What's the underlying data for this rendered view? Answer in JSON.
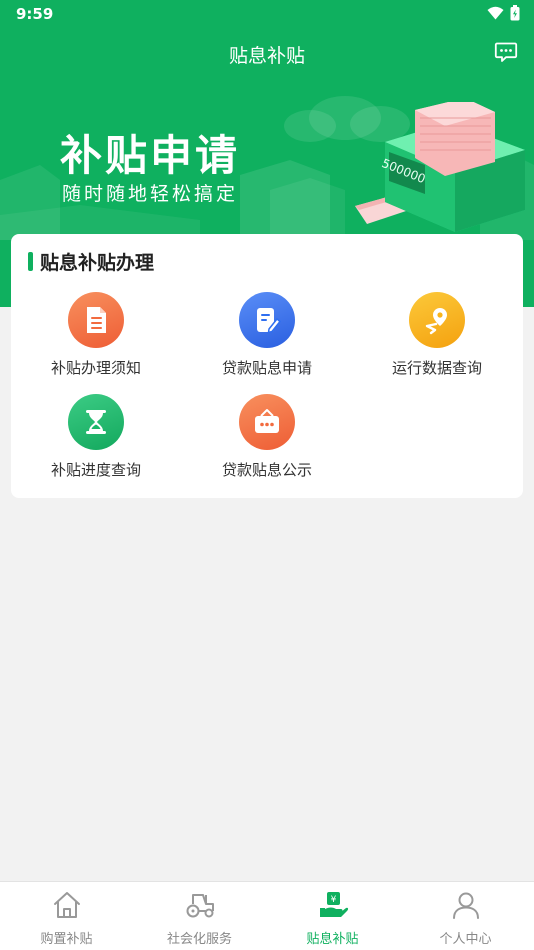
{
  "status": {
    "time": "9:59"
  },
  "header": {
    "title": "贴息补贴"
  },
  "banner": {
    "title": "补贴申请",
    "subtitle": "随时随地轻松搞定",
    "amount": "500000"
  },
  "card": {
    "title": "贴息补贴办理",
    "items": [
      {
        "label": "补贴办理须知",
        "icon": "document-icon",
        "color": "#f26b3f"
      },
      {
        "label": "贷款贴息申请",
        "icon": "edit-form-icon",
        "color": "#2f6ff0"
      },
      {
        "label": "运行数据查询",
        "icon": "location-data-icon",
        "color": "#f8b41c"
      },
      {
        "label": "补贴进度查询",
        "icon": "hourglass-icon",
        "color": "#1bb86a"
      },
      {
        "label": "贷款贴息公示",
        "icon": "notice-board-icon",
        "color": "#f26b3f"
      }
    ]
  },
  "tabs": [
    {
      "label": "购置补贴",
      "icon": "home-icon",
      "active": false
    },
    {
      "label": "社会化服务",
      "icon": "tractor-icon",
      "active": false
    },
    {
      "label": "贴息补贴",
      "icon": "yen-hand-icon",
      "active": true
    },
    {
      "label": "个人中心",
      "icon": "person-icon",
      "active": false
    }
  ],
  "colors": {
    "primary": "#0fb05f",
    "background": "#f2f2f2"
  }
}
